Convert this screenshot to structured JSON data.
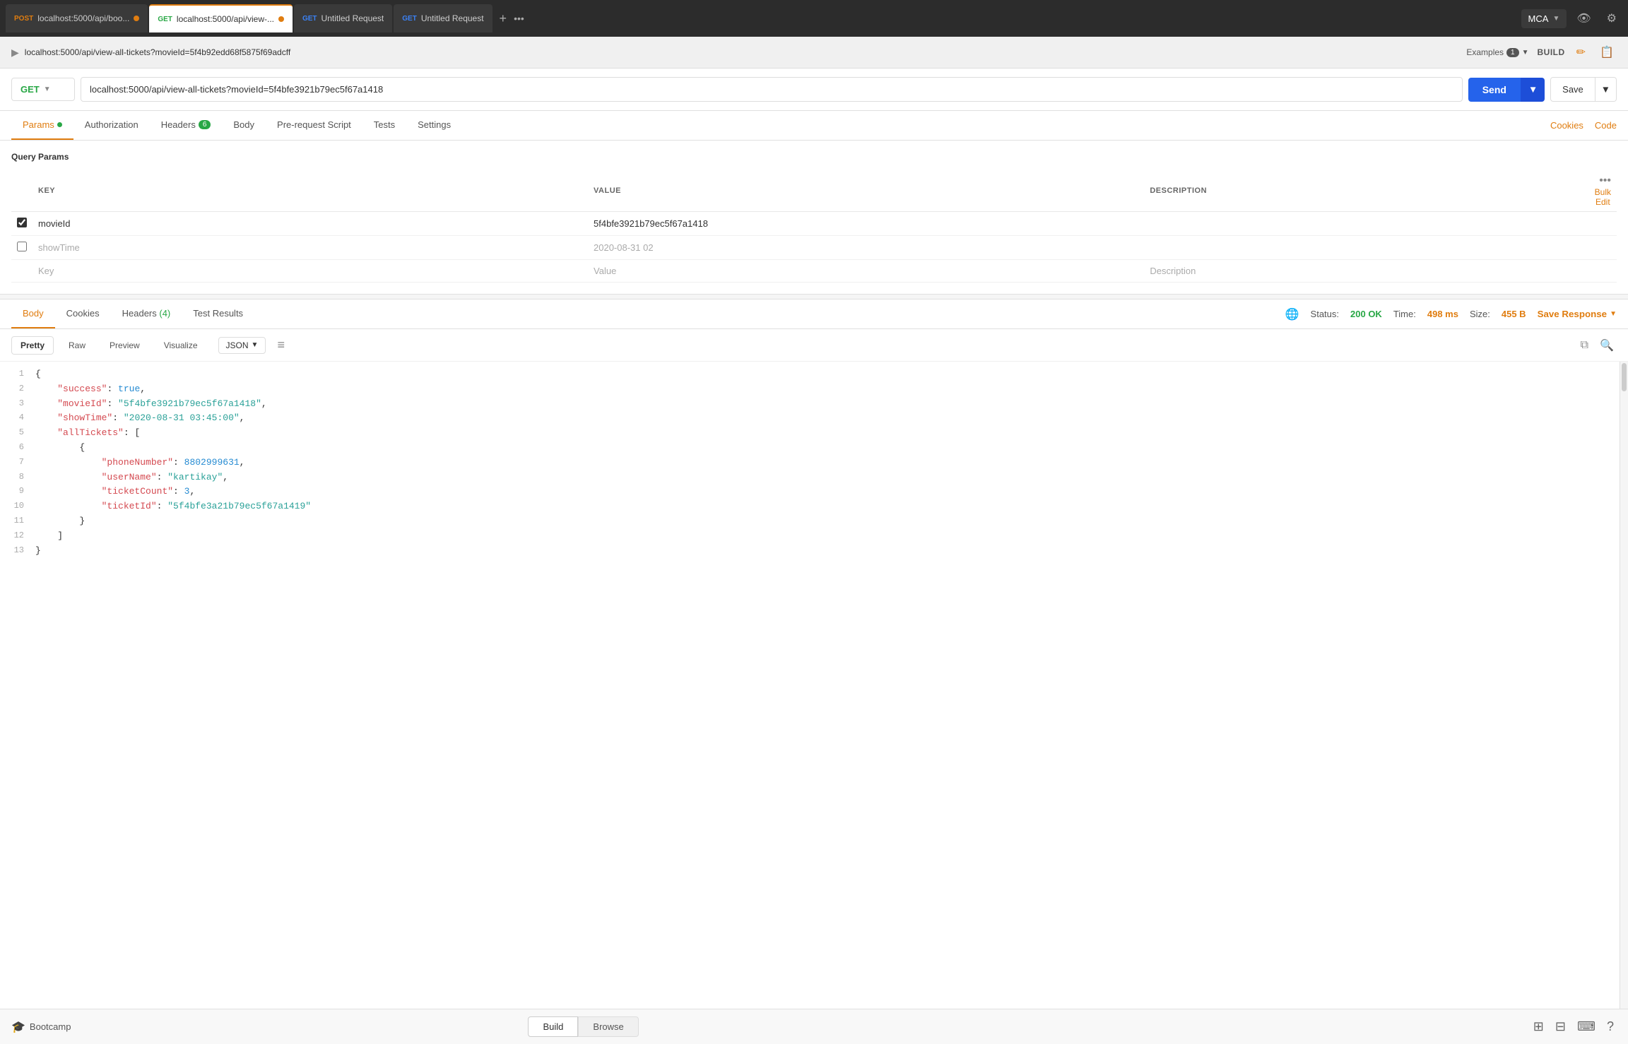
{
  "tabs": [
    {
      "id": "tab1",
      "method": "POST",
      "methodClass": "post",
      "title": "localhost:5000/api/boo...",
      "dot": "orange",
      "active": false
    },
    {
      "id": "tab2",
      "method": "GET",
      "methodClass": "get-active",
      "title": "localhost:5000/api/view-...",
      "dot": "orange",
      "active": true
    },
    {
      "id": "tab3",
      "method": "GET",
      "methodClass": "get",
      "title": "Untitled Request",
      "dot": null,
      "active": false
    },
    {
      "id": "tab4",
      "method": "GET",
      "methodClass": "get",
      "title": "Untitled Request",
      "dot": null,
      "active": false
    }
  ],
  "workspace": {
    "name": "MCA"
  },
  "breadcrumb": {
    "url": "localhost:5000/api/view-all-tickets?movieId=5f4b92edd68f5875f69adcff",
    "examples_label": "Examples",
    "examples_count": "1",
    "build_label": "BUILD"
  },
  "request": {
    "method": "GET",
    "url": "localhost:5000/api/view-all-tickets?movieId=5f4bfe3921b79ec5f67a1418",
    "send_label": "Send",
    "save_label": "Save"
  },
  "nav_tabs": [
    {
      "id": "params",
      "label": "Params",
      "badge": null,
      "hasDot": true,
      "active": true
    },
    {
      "id": "authorization",
      "label": "Authorization",
      "badge": null,
      "hasDot": false,
      "active": false
    },
    {
      "id": "headers",
      "label": "Headers",
      "badge": "6",
      "hasDot": false,
      "active": false
    },
    {
      "id": "body",
      "label": "Body",
      "badge": null,
      "hasDot": false,
      "active": false
    },
    {
      "id": "pre-request",
      "label": "Pre-request Script",
      "badge": null,
      "hasDot": false,
      "active": false
    },
    {
      "id": "tests",
      "label": "Tests",
      "badge": null,
      "hasDot": false,
      "active": false
    },
    {
      "id": "settings",
      "label": "Settings",
      "badge": null,
      "hasDot": false,
      "active": false
    }
  ],
  "right_links": [
    "Cookies",
    "Code"
  ],
  "query_params": {
    "title": "Query Params",
    "columns": {
      "key": "KEY",
      "value": "VALUE",
      "description": "DESCRIPTION"
    },
    "bulk_edit": "Bulk Edit",
    "rows": [
      {
        "checked": true,
        "key": "movieId",
        "value": "5f4bfe3921b79ec5f67a1418",
        "description": ""
      },
      {
        "checked": false,
        "key": "showTime",
        "value": "2020-08-31 02",
        "description": ""
      }
    ],
    "new_row": {
      "key": "Key",
      "value": "Value",
      "description": "Description"
    }
  },
  "response": {
    "tabs": [
      {
        "id": "body",
        "label": "Body",
        "active": true
      },
      {
        "id": "cookies",
        "label": "Cookies",
        "active": false
      },
      {
        "id": "headers",
        "label": "Headers (4)",
        "active": false
      },
      {
        "id": "test-results",
        "label": "Test Results",
        "active": false
      }
    ],
    "status_label": "Status:",
    "status_value": "200 OK",
    "time_label": "Time:",
    "time_value": "498 ms",
    "size_label": "Size:",
    "size_value": "455 B",
    "save_response_label": "Save Response"
  },
  "format_bar": {
    "tabs": [
      "Pretty",
      "Raw",
      "Preview",
      "Visualize"
    ],
    "active_tab": "Pretty",
    "format": "JSON"
  },
  "json_lines": [
    {
      "num": 1,
      "content": "{",
      "type": "brace"
    },
    {
      "num": 2,
      "content": "    \"success\": true,",
      "type": "mixed",
      "parts": [
        {
          "t": "key",
          "v": "\"success\""
        },
        {
          "t": "plain",
          "v": ": "
        },
        {
          "t": "bool",
          "v": "true"
        },
        {
          "t": "plain",
          "v": ","
        }
      ]
    },
    {
      "num": 3,
      "content": "    \"movieId\": \"5f4bfe3921b79ec5f67a1418\",",
      "type": "mixed",
      "parts": [
        {
          "t": "key",
          "v": "\"movieId\""
        },
        {
          "t": "plain",
          "v": ": "
        },
        {
          "t": "string",
          "v": "\"5f4bfe3921b79ec5f67a1418\""
        },
        {
          "t": "plain",
          "v": ","
        }
      ]
    },
    {
      "num": 4,
      "content": "    \"showTime\": \"2020-08-31 03:45:00\",",
      "type": "mixed",
      "parts": [
        {
          "t": "key",
          "v": "\"showTime\""
        },
        {
          "t": "plain",
          "v": ": "
        },
        {
          "t": "string",
          "v": "\"2020-08-31 03:45:00\""
        },
        {
          "t": "plain",
          "v": ","
        }
      ]
    },
    {
      "num": 5,
      "content": "    \"allTickets\": [",
      "type": "mixed",
      "parts": [
        {
          "t": "key",
          "v": "\"allTickets\""
        },
        {
          "t": "plain",
          "v": ": ["
        }
      ]
    },
    {
      "num": 6,
      "content": "        {",
      "type": "brace"
    },
    {
      "num": 7,
      "content": "            \"phoneNumber\": 8802999631,",
      "type": "mixed",
      "parts": [
        {
          "t": "key",
          "v": "\"phoneNumber\""
        },
        {
          "t": "plain",
          "v": ": "
        },
        {
          "t": "number",
          "v": "8802999631"
        },
        {
          "t": "plain",
          "v": ","
        }
      ]
    },
    {
      "num": 8,
      "content": "            \"userName\": \"kartikay\",",
      "type": "mixed",
      "parts": [
        {
          "t": "key",
          "v": "\"userName\""
        },
        {
          "t": "plain",
          "v": ": "
        },
        {
          "t": "string",
          "v": "\"kartikay\""
        },
        {
          "t": "plain",
          "v": ","
        }
      ]
    },
    {
      "num": 9,
      "content": "            \"ticketCount\": 3,",
      "type": "mixed",
      "parts": [
        {
          "t": "key",
          "v": "\"ticketCount\""
        },
        {
          "t": "plain",
          "v": ": "
        },
        {
          "t": "number",
          "v": "3"
        },
        {
          "t": "plain",
          "v": ","
        }
      ]
    },
    {
      "num": 10,
      "content": "            \"ticketId\": \"5f4bfe3a21b79ec5f67a1419\"",
      "type": "mixed",
      "parts": [
        {
          "t": "key",
          "v": "\"ticketId\""
        },
        {
          "t": "plain",
          "v": ": "
        },
        {
          "t": "string",
          "v": "\"5f4bfe3a21b79ec5f67a1419\""
        }
      ]
    },
    {
      "num": 11,
      "content": "        }",
      "type": "brace"
    },
    {
      "num": 12,
      "content": "    ]",
      "type": "bracket"
    },
    {
      "num": 13,
      "content": "}",
      "type": "brace"
    }
  ],
  "bottom_bar": {
    "bootcamp_label": "Bootcamp",
    "build_label": "Build",
    "browse_label": "Browse"
  }
}
